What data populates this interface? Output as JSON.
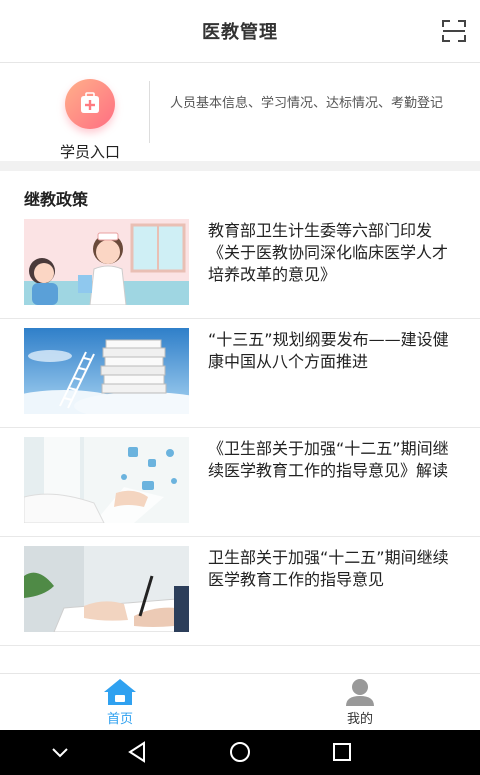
{
  "header": {
    "title": "医教管理",
    "scan_icon": "scan-icon"
  },
  "entry": {
    "label": "学员入口",
    "icon": "medical-kit-icon",
    "description": "人员基本信息、学习情况、达标情况、考勤登记",
    "colors": {
      "gradient_start": "#ffb08a",
      "gradient_end": "#ff6e82"
    }
  },
  "section": {
    "title": "继教政策"
  },
  "news": [
    {
      "title": "教育部卫生计生委等六部门印发《关于医教协同深化临床医学人才培养改革的意见》",
      "thumb": "doctor-nurse-illustration"
    },
    {
      "title": "“十三五”规划纲要发布——建设健康中国从八个方面推进",
      "thumb": "books-ladder-sky"
    },
    {
      "title": "《卫生部关于加强“十二五”期间继续医学教育工作的指导意见》解读",
      "thumb": "medical-hologram"
    },
    {
      "title": "卫生部关于加强“十二五”期间继续医学教育工作的指导意见",
      "thumb": "hand-writing-pen"
    }
  ],
  "bottom_nav": [
    {
      "label": "首页",
      "icon": "home-icon",
      "active": true
    },
    {
      "label": "我的",
      "icon": "user-icon",
      "active": false
    }
  ],
  "colors": {
    "accent": "#2fa1f0",
    "inactive": "#999999"
  }
}
